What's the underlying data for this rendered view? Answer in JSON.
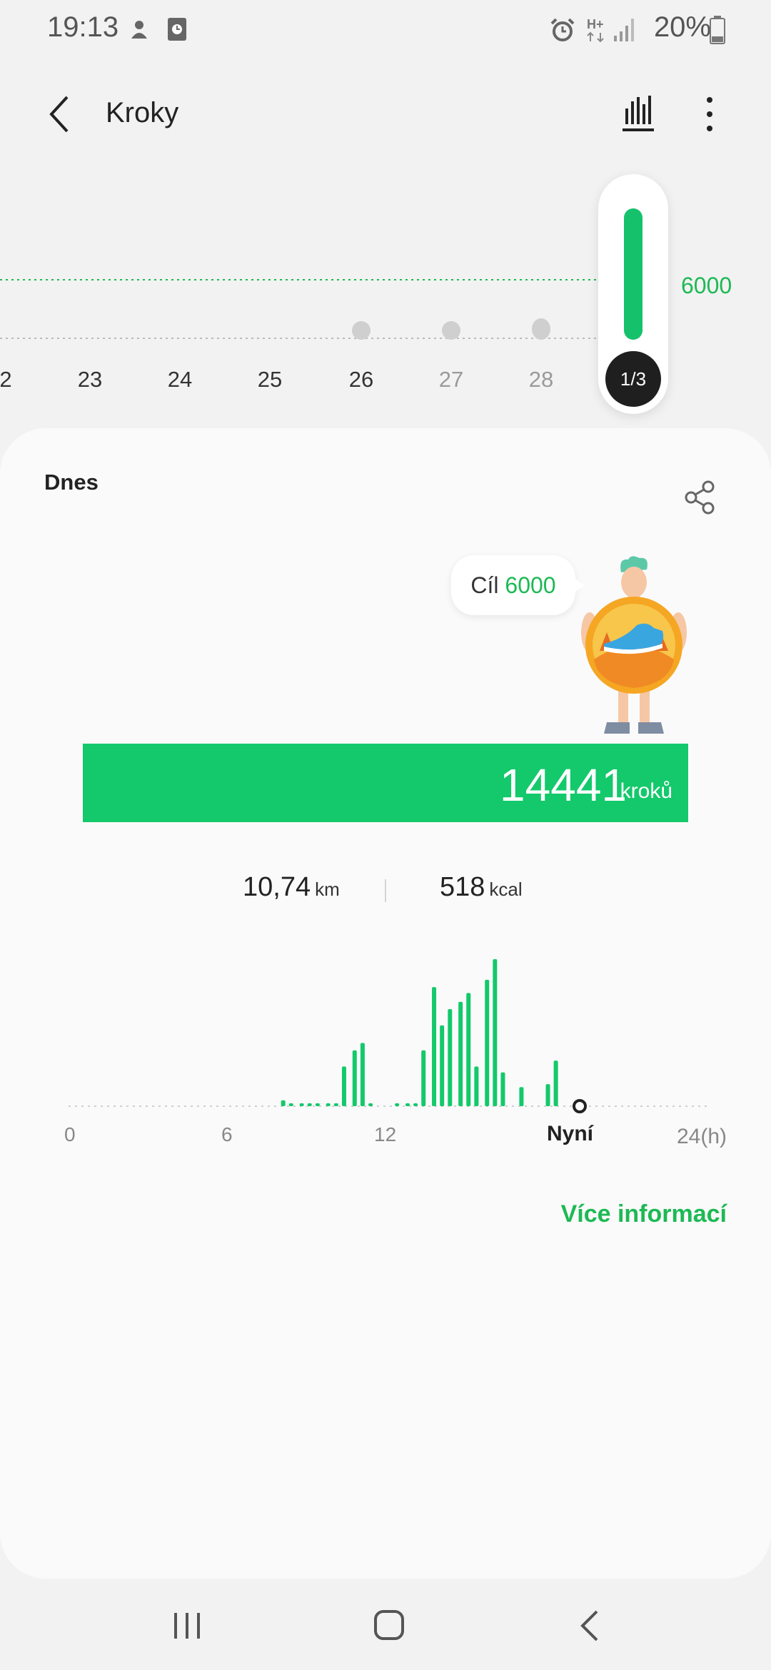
{
  "status_bar": {
    "time": "19:13",
    "battery_percent": "20%",
    "network": "H+"
  },
  "header": {
    "title": "Kroky"
  },
  "week_strip": {
    "days": [
      "2",
      "23",
      "24",
      "25",
      "26",
      "27",
      "28"
    ],
    "goal_value": "6000",
    "current_badge": "1/3"
  },
  "card": {
    "title": "Dnes",
    "goal_label": "Cíl",
    "goal_value": "6000",
    "steps_value": "14441",
    "steps_unit": "kroků",
    "steps_progress": 1.0,
    "distance_value": "10,74",
    "distance_unit": "km",
    "calories_value": "518",
    "calories_unit": "kcal",
    "more_info": "Více informací"
  },
  "chart_data": {
    "type": "bar",
    "x_unit": "h",
    "x_range": [
      0,
      24
    ],
    "x_tick_labels": [
      "0",
      "6",
      "12",
      "Nyní",
      "24(h)"
    ],
    "current_time_hours": 19.2,
    "bars": [
      {
        "x": 8.0,
        "value": 0.04
      },
      {
        "x": 8.3,
        "value": 0.02
      },
      {
        "x": 8.7,
        "value": 0.02
      },
      {
        "x": 9.0,
        "value": 0.02
      },
      {
        "x": 9.3,
        "value": 0.02
      },
      {
        "x": 9.7,
        "value": 0.02
      },
      {
        "x": 10.0,
        "value": 0.02
      },
      {
        "x": 10.3,
        "value": 0.27
      },
      {
        "x": 10.7,
        "value": 0.38
      },
      {
        "x": 11.0,
        "value": 0.43
      },
      {
        "x": 11.3,
        "value": 0.02
      },
      {
        "x": 12.3,
        "value": 0.02
      },
      {
        "x": 12.7,
        "value": 0.02
      },
      {
        "x": 13.0,
        "value": 0.02
      },
      {
        "x": 13.3,
        "value": 0.38
      },
      {
        "x": 13.7,
        "value": 0.81
      },
      {
        "x": 14.0,
        "value": 0.55
      },
      {
        "x": 14.3,
        "value": 0.66
      },
      {
        "x": 14.7,
        "value": 0.71
      },
      {
        "x": 15.0,
        "value": 0.77
      },
      {
        "x": 15.3,
        "value": 0.27
      },
      {
        "x": 15.7,
        "value": 0.86
      },
      {
        "x": 16.0,
        "value": 1.0
      },
      {
        "x": 16.3,
        "value": 0.23
      },
      {
        "x": 17.0,
        "value": 0.13
      },
      {
        "x": 18.0,
        "value": 0.15
      },
      {
        "x": 18.3,
        "value": 0.31
      }
    ]
  }
}
